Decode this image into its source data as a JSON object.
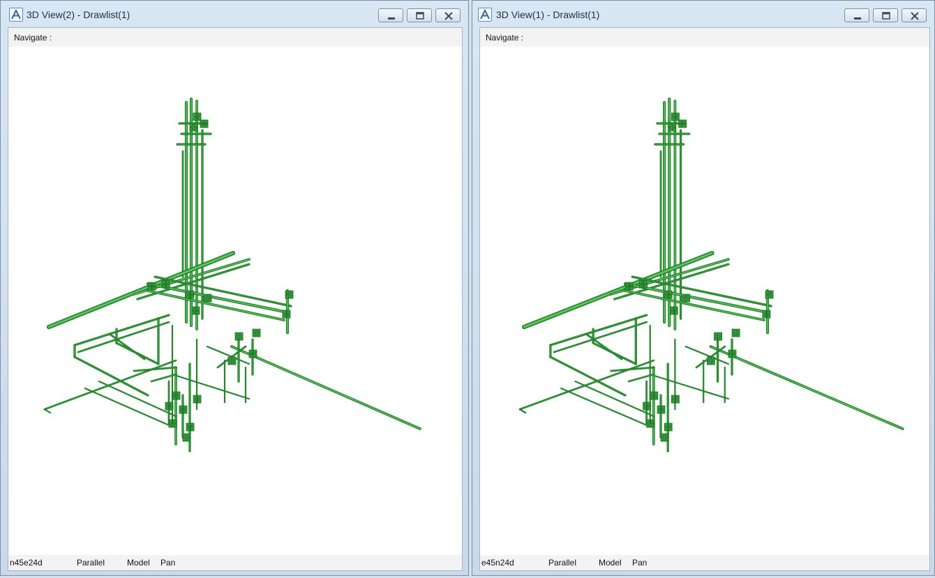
{
  "windows": [
    {
      "id": "left",
      "title": "3D View(2) - Drawlist(1)",
      "navigate_label": "Navigate :",
      "status": {
        "direction": "n45e24d",
        "projection": "Parallel",
        "mode": "Model",
        "action": "Pan"
      }
    },
    {
      "id": "right",
      "title": "3D View(1) - Drawlist(1)",
      "navigate_label": "Navigate :",
      "status": {
        "direction": "e45n24d",
        "projection": "Parallel",
        "mode": "Model",
        "action": "Pan"
      }
    }
  ],
  "colors": {
    "pipe": "#2f9a36",
    "pipe_dark": "#1e6b25",
    "pipe_light": "#6fd06f"
  },
  "icons": {
    "app": "aveva-app-icon",
    "minimize": "minimize-icon",
    "maximize": "maximize-icon",
    "close": "close-icon"
  }
}
